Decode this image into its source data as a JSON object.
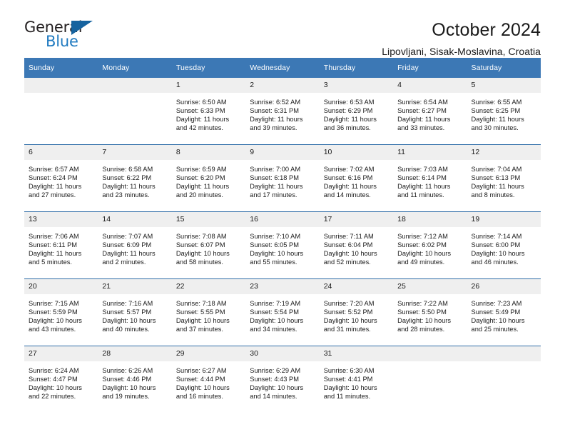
{
  "logo": {
    "word_top": "General",
    "word_bottom": "Blue",
    "triangle_color": "#16639f",
    "blue_color": "#1f7ac0"
  },
  "header": {
    "title": "October 2024",
    "subtitle": "Lipovljani, Sisak-Moslavina, Croatia"
  },
  "theme": {
    "header_blue": "#3c78b5",
    "row_divider_blue": "#2f6da8",
    "daynum_band": "#efefef"
  },
  "weekday_headers": [
    "Sunday",
    "Monday",
    "Tuesday",
    "Wednesday",
    "Thursday",
    "Friday",
    "Saturday"
  ],
  "weeks": [
    [
      {
        "day": "",
        "empty": true
      },
      {
        "day": "",
        "empty": true
      },
      {
        "day": "1",
        "sunrise": "Sunrise: 6:50 AM",
        "sunset": "Sunset: 6:33 PM",
        "daylight1": "Daylight: 11 hours",
        "daylight2": "and 42 minutes."
      },
      {
        "day": "2",
        "sunrise": "Sunrise: 6:52 AM",
        "sunset": "Sunset: 6:31 PM",
        "daylight1": "Daylight: 11 hours",
        "daylight2": "and 39 minutes."
      },
      {
        "day": "3",
        "sunrise": "Sunrise: 6:53 AM",
        "sunset": "Sunset: 6:29 PM",
        "daylight1": "Daylight: 11 hours",
        "daylight2": "and 36 minutes."
      },
      {
        "day": "4",
        "sunrise": "Sunrise: 6:54 AM",
        "sunset": "Sunset: 6:27 PM",
        "daylight1": "Daylight: 11 hours",
        "daylight2": "and 33 minutes."
      },
      {
        "day": "5",
        "sunrise": "Sunrise: 6:55 AM",
        "sunset": "Sunset: 6:25 PM",
        "daylight1": "Daylight: 11 hours",
        "daylight2": "and 30 minutes."
      }
    ],
    [
      {
        "day": "6",
        "sunrise": "Sunrise: 6:57 AM",
        "sunset": "Sunset: 6:24 PM",
        "daylight1": "Daylight: 11 hours",
        "daylight2": "and 27 minutes."
      },
      {
        "day": "7",
        "sunrise": "Sunrise: 6:58 AM",
        "sunset": "Sunset: 6:22 PM",
        "daylight1": "Daylight: 11 hours",
        "daylight2": "and 23 minutes."
      },
      {
        "day": "8",
        "sunrise": "Sunrise: 6:59 AM",
        "sunset": "Sunset: 6:20 PM",
        "daylight1": "Daylight: 11 hours",
        "daylight2": "and 20 minutes."
      },
      {
        "day": "9",
        "sunrise": "Sunrise: 7:00 AM",
        "sunset": "Sunset: 6:18 PM",
        "daylight1": "Daylight: 11 hours",
        "daylight2": "and 17 minutes."
      },
      {
        "day": "10",
        "sunrise": "Sunrise: 7:02 AM",
        "sunset": "Sunset: 6:16 PM",
        "daylight1": "Daylight: 11 hours",
        "daylight2": "and 14 minutes."
      },
      {
        "day": "11",
        "sunrise": "Sunrise: 7:03 AM",
        "sunset": "Sunset: 6:14 PM",
        "daylight1": "Daylight: 11 hours",
        "daylight2": "and 11 minutes."
      },
      {
        "day": "12",
        "sunrise": "Sunrise: 7:04 AM",
        "sunset": "Sunset: 6:13 PM",
        "daylight1": "Daylight: 11 hours",
        "daylight2": "and 8 minutes."
      }
    ],
    [
      {
        "day": "13",
        "sunrise": "Sunrise: 7:06 AM",
        "sunset": "Sunset: 6:11 PM",
        "daylight1": "Daylight: 11 hours",
        "daylight2": "and 5 minutes."
      },
      {
        "day": "14",
        "sunrise": "Sunrise: 7:07 AM",
        "sunset": "Sunset: 6:09 PM",
        "daylight1": "Daylight: 11 hours",
        "daylight2": "and 2 minutes."
      },
      {
        "day": "15",
        "sunrise": "Sunrise: 7:08 AM",
        "sunset": "Sunset: 6:07 PM",
        "daylight1": "Daylight: 10 hours",
        "daylight2": "and 58 minutes."
      },
      {
        "day": "16",
        "sunrise": "Sunrise: 7:10 AM",
        "sunset": "Sunset: 6:05 PM",
        "daylight1": "Daylight: 10 hours",
        "daylight2": "and 55 minutes."
      },
      {
        "day": "17",
        "sunrise": "Sunrise: 7:11 AM",
        "sunset": "Sunset: 6:04 PM",
        "daylight1": "Daylight: 10 hours",
        "daylight2": "and 52 minutes."
      },
      {
        "day": "18",
        "sunrise": "Sunrise: 7:12 AM",
        "sunset": "Sunset: 6:02 PM",
        "daylight1": "Daylight: 10 hours",
        "daylight2": "and 49 minutes."
      },
      {
        "day": "19",
        "sunrise": "Sunrise: 7:14 AM",
        "sunset": "Sunset: 6:00 PM",
        "daylight1": "Daylight: 10 hours",
        "daylight2": "and 46 minutes."
      }
    ],
    [
      {
        "day": "20",
        "sunrise": "Sunrise: 7:15 AM",
        "sunset": "Sunset: 5:59 PM",
        "daylight1": "Daylight: 10 hours",
        "daylight2": "and 43 minutes."
      },
      {
        "day": "21",
        "sunrise": "Sunrise: 7:16 AM",
        "sunset": "Sunset: 5:57 PM",
        "daylight1": "Daylight: 10 hours",
        "daylight2": "and 40 minutes."
      },
      {
        "day": "22",
        "sunrise": "Sunrise: 7:18 AM",
        "sunset": "Sunset: 5:55 PM",
        "daylight1": "Daylight: 10 hours",
        "daylight2": "and 37 minutes."
      },
      {
        "day": "23",
        "sunrise": "Sunrise: 7:19 AM",
        "sunset": "Sunset: 5:54 PM",
        "daylight1": "Daylight: 10 hours",
        "daylight2": "and 34 minutes."
      },
      {
        "day": "24",
        "sunrise": "Sunrise: 7:20 AM",
        "sunset": "Sunset: 5:52 PM",
        "daylight1": "Daylight: 10 hours",
        "daylight2": "and 31 minutes."
      },
      {
        "day": "25",
        "sunrise": "Sunrise: 7:22 AM",
        "sunset": "Sunset: 5:50 PM",
        "daylight1": "Daylight: 10 hours",
        "daylight2": "and 28 minutes."
      },
      {
        "day": "26",
        "sunrise": "Sunrise: 7:23 AM",
        "sunset": "Sunset: 5:49 PM",
        "daylight1": "Daylight: 10 hours",
        "daylight2": "and 25 minutes."
      }
    ],
    [
      {
        "day": "27",
        "sunrise": "Sunrise: 6:24 AM",
        "sunset": "Sunset: 4:47 PM",
        "daylight1": "Daylight: 10 hours",
        "daylight2": "and 22 minutes."
      },
      {
        "day": "28",
        "sunrise": "Sunrise: 6:26 AM",
        "sunset": "Sunset: 4:46 PM",
        "daylight1": "Daylight: 10 hours",
        "daylight2": "and 19 minutes."
      },
      {
        "day": "29",
        "sunrise": "Sunrise: 6:27 AM",
        "sunset": "Sunset: 4:44 PM",
        "daylight1": "Daylight: 10 hours",
        "daylight2": "and 16 minutes."
      },
      {
        "day": "30",
        "sunrise": "Sunrise: 6:29 AM",
        "sunset": "Sunset: 4:43 PM",
        "daylight1": "Daylight: 10 hours",
        "daylight2": "and 14 minutes."
      },
      {
        "day": "31",
        "sunrise": "Sunrise: 6:30 AM",
        "sunset": "Sunset: 4:41 PM",
        "daylight1": "Daylight: 10 hours",
        "daylight2": "and 11 minutes."
      },
      {
        "day": "",
        "empty": true
      },
      {
        "day": "",
        "empty": true
      }
    ]
  ]
}
